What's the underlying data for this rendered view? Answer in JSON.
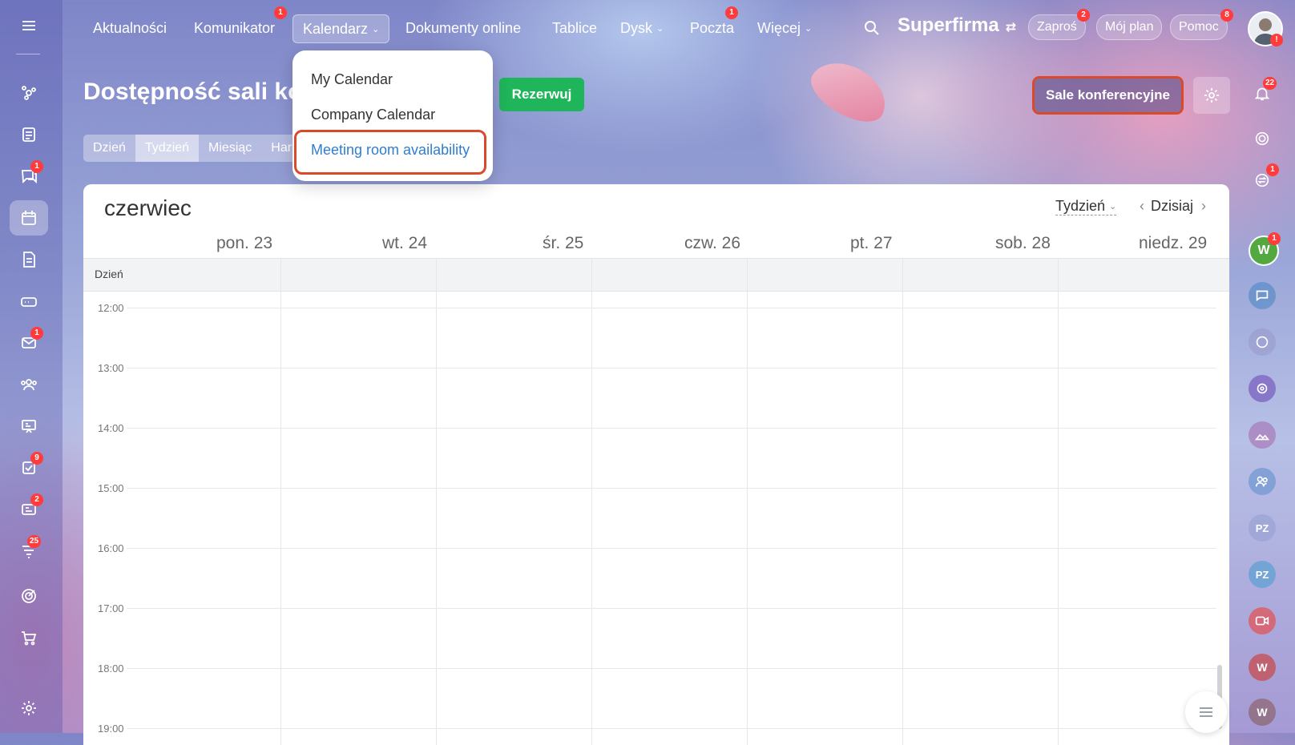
{
  "top_nav": {
    "items": [
      {
        "label": "Aktualności"
      },
      {
        "label": "Komunikator",
        "badge": "1"
      },
      {
        "label": "Kalendarz"
      },
      {
        "label": "Dokumenty online"
      },
      {
        "label": "Tablice"
      },
      {
        "label": "Dysk"
      },
      {
        "label": "Poczta",
        "badge": "1"
      },
      {
        "label": "Więcej"
      }
    ],
    "company": "Superfirma",
    "invite": {
      "label": "Zaproś",
      "badge": "2"
    },
    "plan": {
      "label": "Mój plan"
    },
    "help": {
      "label": "Pomoc",
      "badge": "8"
    },
    "avatar_alert": "!"
  },
  "dropdown": {
    "items": [
      "My Calendar",
      "Company Calendar",
      "Meeting room availability"
    ]
  },
  "page": {
    "title": "Dostępność sali ko",
    "reserve_button": "Rezerwuj",
    "rooms_button": "Sale konferencyjne",
    "tabs": [
      "Dzień",
      "Tydzień",
      "Miesiąc",
      "Har"
    ],
    "active_tab": "Tydzień"
  },
  "calendar": {
    "month": "czerwiec",
    "view": "Tydzień",
    "today": "Dzisiaj",
    "days": [
      "pon. 23",
      "wt. 24",
      "śr. 25",
      "czw. 26",
      "pt. 27",
      "sob. 28",
      "niedz. 29"
    ],
    "allday_label": "Dzień",
    "hours": [
      "12:00",
      "13:00",
      "14:00",
      "15:00",
      "16:00",
      "17:00",
      "18:00",
      "19:00"
    ]
  },
  "left_sidebar": {
    "badges": {
      "chat": "1",
      "mail": "1",
      "tasks": "9",
      "crm": "2",
      "funnel": "25"
    }
  },
  "right_sidebar": {
    "notifications_badge": "22",
    "chat_badge": "1",
    "user_w_badge": "1",
    "avatars": [
      "W",
      "PZ",
      "PZ",
      "W",
      "W"
    ]
  },
  "colors": {
    "accent_green": "#1fb55a",
    "highlight_red": "#d94a2b",
    "badge_red": "#ff3b3b",
    "link_blue": "#2f7dd1"
  }
}
